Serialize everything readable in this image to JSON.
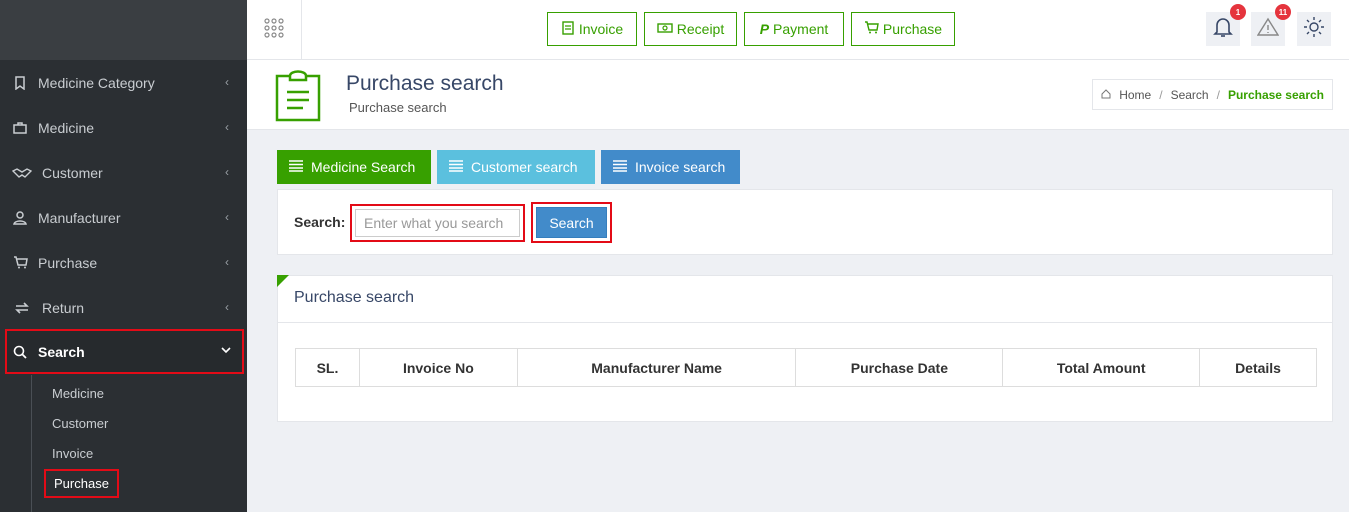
{
  "sidebar": {
    "items": [
      {
        "label": "Medicine Category",
        "icon": "bookmark-icon"
      },
      {
        "label": "Medicine",
        "icon": "briefcase-icon"
      },
      {
        "label": "Customer",
        "icon": "handshake-icon"
      },
      {
        "label": "Manufacturer",
        "icon": "user-icon"
      },
      {
        "label": "Purchase",
        "icon": "cart-icon"
      },
      {
        "label": "Return",
        "icon": "exchange-icon"
      },
      {
        "label": "Search",
        "icon": "search-icon"
      }
    ],
    "search_subitems": [
      "Medicine",
      "Customer",
      "Invoice",
      "Purchase"
    ]
  },
  "topbar": {
    "quick_buttons": [
      {
        "label": "Invoice",
        "icon": "invoice-icon"
      },
      {
        "label": "Receipt",
        "icon": "money-icon"
      },
      {
        "label": "Payment",
        "icon": "paypal-icon"
      },
      {
        "label": "Purchase",
        "icon": "cart-icon"
      }
    ],
    "notifications_count": "1",
    "alerts_count": "11"
  },
  "header": {
    "title": "Purchase search",
    "subtitle": "Purchase search",
    "breadcrumb": [
      "Home",
      "Search",
      "Purchase search"
    ]
  },
  "search_tabs": [
    {
      "label": "Medicine Search",
      "color": "#37a000"
    },
    {
      "label": "Customer search",
      "color": "#5bc0de"
    },
    {
      "label": "Invoice search",
      "color": "#428bca"
    }
  ],
  "search_form": {
    "label": "Search:",
    "placeholder": "Enter what you search",
    "button_label": "Search"
  },
  "results_panel": {
    "title": "Purchase search",
    "columns": [
      "SL.",
      "Invoice No",
      "Manufacturer Name",
      "Purchase Date",
      "Total Amount",
      "Details"
    ]
  },
  "colors": {
    "accent_green": "#37a000",
    "highlight_red": "#e30b17",
    "sidebar_bg": "#2b2f33"
  }
}
